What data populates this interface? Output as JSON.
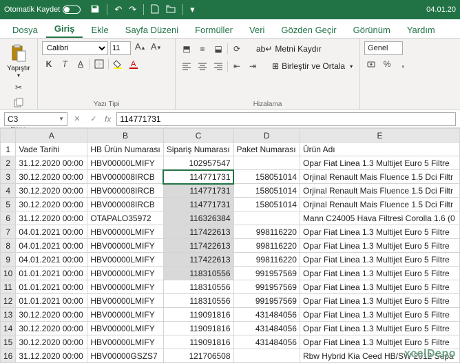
{
  "titlebar": {
    "autosave_label": "Otomatik Kaydet",
    "date": "04.01.20"
  },
  "menu": {
    "tabs": [
      "Dosya",
      "Giriş",
      "Ekle",
      "Sayfa Düzeni",
      "Formüller",
      "Veri",
      "Gözden Geçir",
      "Görünüm",
      "Yardım"
    ],
    "active": 1
  },
  "ribbon": {
    "paste_label": "Yapıştır",
    "clipboard_title": "Pano",
    "font_name": "Calibri",
    "font_size": "11",
    "font_title": "Yazı Tipi",
    "wrap_label": "Metni Kaydır",
    "merge_label": "Birleştir ve Ortala",
    "align_title": "Hizalama",
    "number_format": "Genel"
  },
  "namebox": "C3",
  "formula": "114771731",
  "columns": [
    "A",
    "B",
    "C",
    "D",
    "E"
  ],
  "header_row": [
    "Vade Tarihi",
    "HB Ürün Numarası",
    "Sipariş Numarası",
    "Paket Numarası",
    "Ürün Adı"
  ],
  "rows": [
    {
      "n": 2,
      "A": "31.12.2020 00:00",
      "B": "HBV00000LMIFY",
      "C": "102957547",
      "D": "",
      "E": "Opar Fiat Linea 1.3 Multijet Euro 5 Filtre"
    },
    {
      "n": 3,
      "A": "30.12.2020 00:00",
      "B": "HBV000008IRCB",
      "C": "114771731",
      "D": "158051014",
      "E": "Orjinal Renault Mais Fluence 1.5 Dci Filtr"
    },
    {
      "n": 4,
      "A": "30.12.2020 00:00",
      "B": "HBV000008IRCB",
      "C": "114771731",
      "D": "158051014",
      "E": "Orjinal Renault Mais Fluence 1.5 Dci Filtr"
    },
    {
      "n": 5,
      "A": "30.12.2020 00:00",
      "B": "HBV000008IRCB",
      "C": "114771731",
      "D": "158051014",
      "E": "Orjinal Renault Mais Fluence 1.5 Dci Filtr"
    },
    {
      "n": 6,
      "A": "31.12.2020 00:00",
      "B": "OTAPALO35972",
      "C": "116326384",
      "D": "",
      "E": "Mann C24005 Hava Filtresi Corolla 1.6 (0"
    },
    {
      "n": 7,
      "A": "04.01.2021 00:00",
      "B": "HBV00000LMIFY",
      "C": "117422613",
      "D": "998116220",
      "E": "Opar Fiat Linea 1.3 Multijet Euro 5 Filtre"
    },
    {
      "n": 8,
      "A": "04.01.2021 00:00",
      "B": "HBV00000LMIFY",
      "C": "117422613",
      "D": "998116220",
      "E": "Opar Fiat Linea 1.3 Multijet Euro 5 Filtre"
    },
    {
      "n": 9,
      "A": "04.01.2021 00:00",
      "B": "HBV00000LMIFY",
      "C": "117422613",
      "D": "998116220",
      "E": "Opar Fiat Linea 1.3 Multijet Euro 5 Filtre"
    },
    {
      "n": 10,
      "A": "01.01.2021 00:00",
      "B": "HBV00000LMIFY",
      "C": "118310556",
      "D": "991957569",
      "E": "Opar Fiat Linea 1.3 Multijet Euro 5 Filtre"
    },
    {
      "n": 11,
      "A": "01.01.2021 00:00",
      "B": "HBV00000LMIFY",
      "C": "118310556",
      "D": "991957569",
      "E": "Opar Fiat Linea 1.3 Multijet Euro 5 Filtre"
    },
    {
      "n": 12,
      "A": "01.01.2021 00:00",
      "B": "HBV00000LMIFY",
      "C": "118310556",
      "D": "991957569",
      "E": "Opar Fiat Linea 1.3 Multijet Euro 5 Filtre"
    },
    {
      "n": 13,
      "A": "30.12.2020 00:00",
      "B": "HBV00000LMIFY",
      "C": "119091816",
      "D": "431484056",
      "E": "Opar Fiat Linea 1.3 Multijet Euro 5 Filtre"
    },
    {
      "n": 14,
      "A": "30.12.2020 00:00",
      "B": "HBV00000LMIFY",
      "C": "119091816",
      "D": "431484056",
      "E": "Opar Fiat Linea 1.3 Multijet Euro 5 Filtre"
    },
    {
      "n": 15,
      "A": "30.12.2020 00:00",
      "B": "HBV00000LMIFY",
      "C": "119091816",
      "D": "431484056",
      "E": "Opar Fiat Linea 1.3 Multijet Euro 5 Filtre"
    },
    {
      "n": 16,
      "A": "31.12.2020 00:00",
      "B": "HBV00000GSZS7",
      "C": "121706508",
      "D": "",
      "E": "Rbw Hybrid Kia Ceed HB/SW 2012 Sepa"
    }
  ],
  "selection": {
    "activeCell": "C3",
    "rangeColC": [
      3,
      10
    ]
  },
  "watermark": "xcelDepo"
}
